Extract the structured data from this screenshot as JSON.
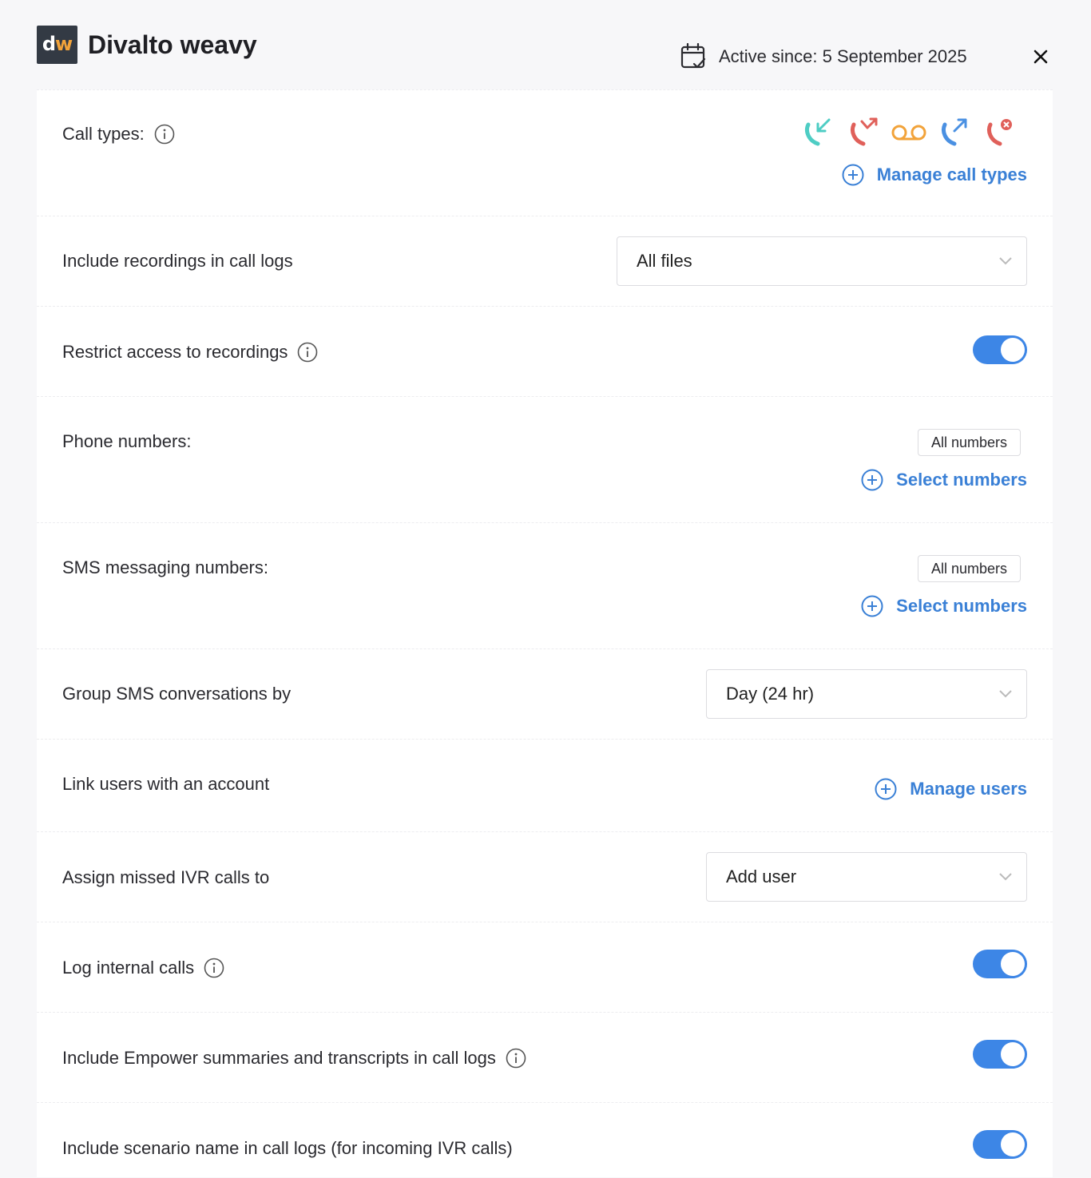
{
  "header": {
    "logo_letters": [
      "d",
      "w"
    ],
    "logo_text": "dw",
    "app_name": "Divalto weavy",
    "active_since": "Active since: 5 September 2025"
  },
  "settings": {
    "call_types": {
      "label": "Call types:",
      "icons": [
        "incoming-call-icon",
        "missed-call-icon",
        "voicemail-icon",
        "outgoing-call-icon",
        "rejected-call-icon"
      ],
      "manage_label": "Manage call types"
    },
    "recordings": {
      "label": "Include recordings in call logs",
      "value": "All files"
    },
    "restrict_recordings": {
      "label": "Restrict access to recordings",
      "enabled": true
    },
    "phone_numbers": {
      "label": "Phone numbers:",
      "chip": "All numbers",
      "select_label": "Select numbers"
    },
    "sms_numbers": {
      "label": "SMS messaging numbers:",
      "chip": "All numbers",
      "select_label": "Select numbers"
    },
    "group_sms": {
      "label": "Group SMS conversations by",
      "value": "Day (24 hr)"
    },
    "link_users": {
      "label": "Link users with an account",
      "manage_label": "Manage users"
    },
    "missed_ivr": {
      "label": "Assign missed IVR calls to",
      "value": "Add user"
    },
    "log_internal": {
      "label": "Log internal calls",
      "enabled": true
    },
    "empower": {
      "label": "Include Empower summaries and transcripts in call logs",
      "enabled": true
    },
    "scenario_name": {
      "label": "Include scenario name in call logs (for incoming IVR calls)",
      "enabled": true
    }
  },
  "colors": {
    "accent": "#3d86e6",
    "link": "#3a80d6",
    "incoming": "#4ecdc4",
    "missed": "#e0605a",
    "voicemail": "#f2a33a",
    "outgoing": "#4a90e2"
  }
}
